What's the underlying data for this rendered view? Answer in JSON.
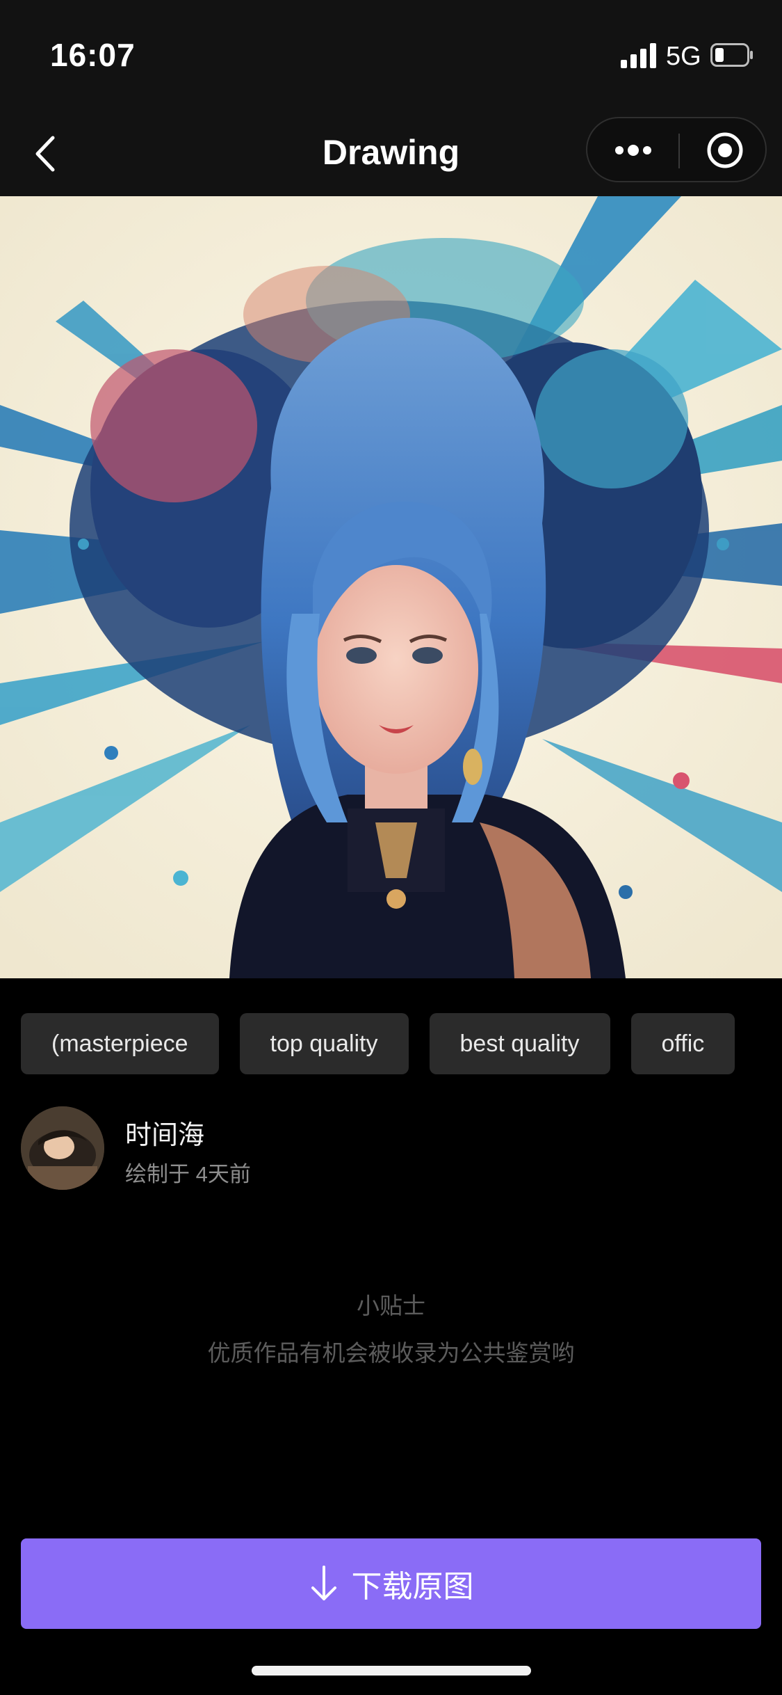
{
  "status_bar": {
    "time": "16:07",
    "network": "5G",
    "signal_icon": "cellular-signal-icon",
    "battery_icon": "battery-icon"
  },
  "nav": {
    "title": "Drawing",
    "back_icon": "chevron-left-icon",
    "more_icon": "more-dots-icon",
    "close_icon": "target-circle-icon"
  },
  "artwork": {
    "icon": "generated-artwork-image"
  },
  "tags": [
    "(masterpiece",
    "top quality",
    "best quality",
    "offic"
  ],
  "author": {
    "name": "时间海",
    "meta": "绘制于 4天前"
  },
  "tip": {
    "title": "小贴士",
    "text": "优质作品有机会被收录为公共鉴赏哟"
  },
  "download": {
    "label": "下载原图",
    "icon": "download-arrow-icon"
  },
  "colors": {
    "accent": "#8a6cf6",
    "background": "#000000",
    "bar_background": "#121212",
    "tag_background": "#2b2b2b"
  }
}
